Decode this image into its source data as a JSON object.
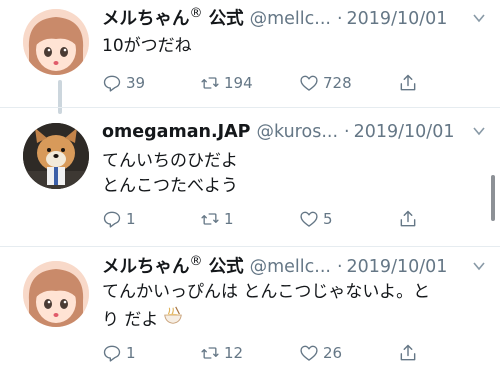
{
  "tweets": [
    {
      "name": "メルちゃん",
      "reg": "®",
      "name_suffix": " 公式",
      "handle": "@mellc...",
      "dot": "·",
      "date": "2019/10/01",
      "text_lines": [
        "10がつだね"
      ],
      "reply_count": "39",
      "retweet_count": "194",
      "like_count": "728"
    },
    {
      "name": "omegaman.JAP",
      "handle": "@kuros...",
      "dot": "·",
      "date": "2019/10/01",
      "text_lines": [
        "てんいちのひだよ",
        "とんこつたべよう"
      ],
      "reply_count": "1",
      "retweet_count": "1",
      "like_count": "5"
    },
    {
      "name": "メルちゃん",
      "reg": "®",
      "name_suffix": " 公式",
      "handle": "@mellc...",
      "dot": "·",
      "date": "2019/10/01",
      "text_lines": [
        "てんかいっぴんは とんこつじゃないよ。と",
        "り だよ"
      ],
      "reply_count": "1",
      "retweet_count": "12",
      "like_count": "26"
    }
  ],
  "icons": {
    "reply": "reply-icon",
    "retweet": "retweet-icon",
    "like": "heart-icon",
    "share": "share-icon",
    "caret": "chevron-down-icon",
    "emoji": "ramen-bowl-emoji"
  },
  "colors": {
    "text": "#14171a",
    "secondary": "#657786",
    "thread_line": "#ccd6dd",
    "divider": "#e6ecf0"
  }
}
